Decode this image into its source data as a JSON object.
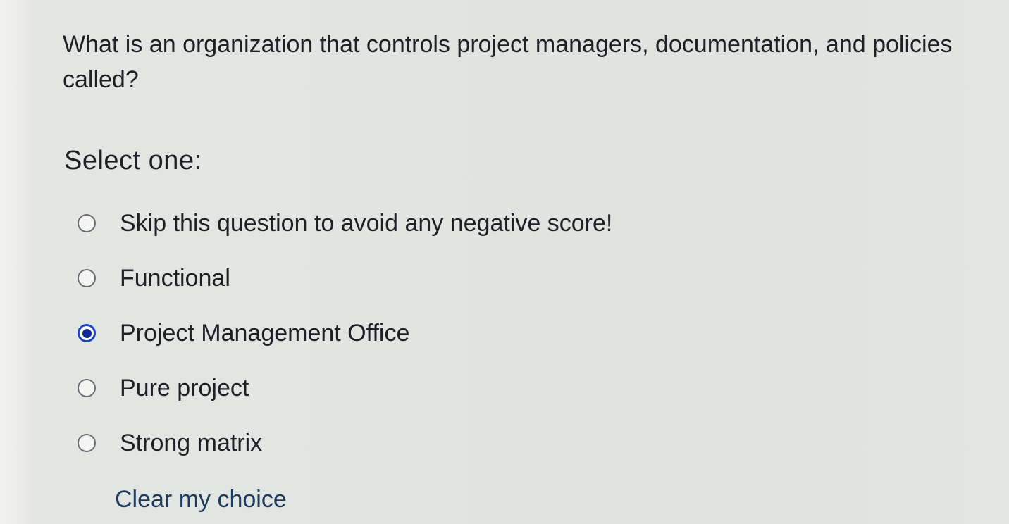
{
  "question": {
    "text": "What is an organization that controls project managers, documentation, and policies called?"
  },
  "prompt": {
    "select_one": "Select one:"
  },
  "options": [
    {
      "label": "Skip this question to avoid any negative score!",
      "selected": false
    },
    {
      "label": "Functional",
      "selected": false
    },
    {
      "label": "Project Management Office",
      "selected": true
    },
    {
      "label": "Pure project",
      "selected": false
    },
    {
      "label": "Strong matrix",
      "selected": false
    }
  ],
  "actions": {
    "clear_choice": "Clear my choice"
  },
  "colors": {
    "selected_radio": "#1f44c9",
    "link": "#1d3b5e"
  }
}
